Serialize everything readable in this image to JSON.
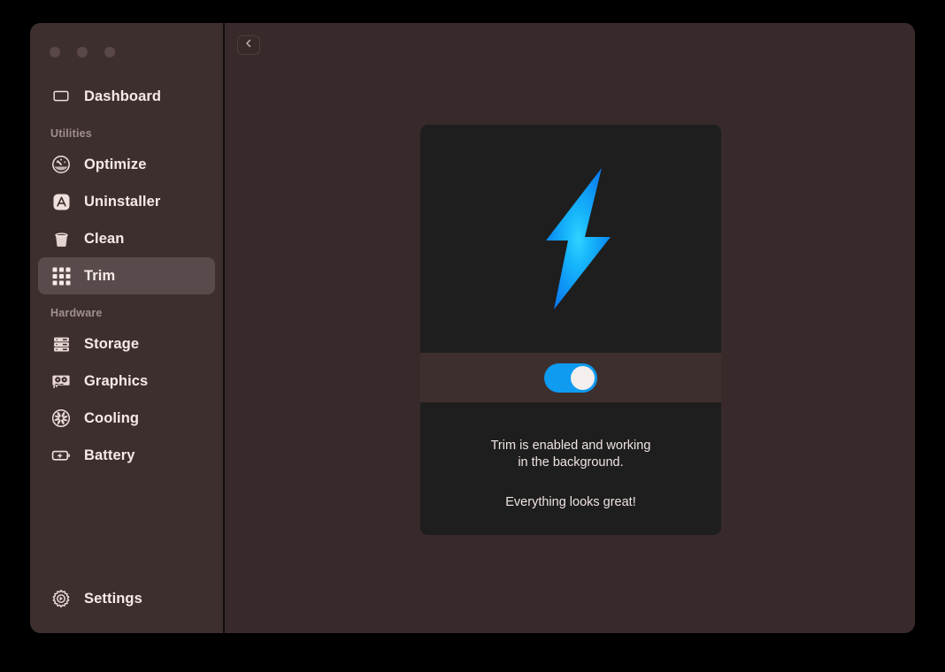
{
  "window": {
    "traffic_lights": [
      "close",
      "minimize",
      "zoom"
    ]
  },
  "sidebar": {
    "dashboard": {
      "label": "Dashboard",
      "icon": "laptop-icon"
    },
    "sections": [
      {
        "label": "Utilities",
        "items": [
          {
            "label": "Optimize",
            "icon": "speedometer-icon",
            "selected": false
          },
          {
            "label": "Uninstaller",
            "icon": "app-store-icon",
            "selected": false
          },
          {
            "label": "Clean",
            "icon": "trash-icon",
            "selected": false
          },
          {
            "label": "Trim",
            "icon": "grid-icon",
            "selected": true
          }
        ]
      },
      {
        "label": "Hardware",
        "items": [
          {
            "label": "Storage",
            "icon": "drive-stack-icon",
            "selected": false
          },
          {
            "label": "Graphics",
            "icon": "gpu-card-icon",
            "selected": false
          },
          {
            "label": "Cooling",
            "icon": "fan-icon",
            "selected": false
          },
          {
            "label": "Battery",
            "icon": "battery-bolt-icon",
            "selected": false
          }
        ]
      }
    ],
    "settings": {
      "label": "Settings",
      "icon": "gear-icon"
    }
  },
  "content": {
    "back_button": {
      "icon": "chevron-left-icon",
      "label": "Back"
    },
    "card": {
      "hero_icon": "lightning-bolt-icon",
      "toggle": {
        "state": "on",
        "accent_color": "#0E9BF0",
        "knob_color": "#F4EEEC"
      },
      "status_primary": "Trim is enabled and working\nin the background.",
      "status_primary_line1": "Trim is enabled and working",
      "status_primary_line2": "in the background.",
      "status_secondary": "Everything looks great!"
    }
  },
  "colors": {
    "desktop": "#000000",
    "sidebar": "#3E2F2F",
    "content": "#382A2A",
    "card": "#1E1E1E",
    "selected_row": "#594B4B",
    "accent": "#0E9BF0",
    "text": "#F6EAE8",
    "muted_text": "#A08F8D"
  }
}
